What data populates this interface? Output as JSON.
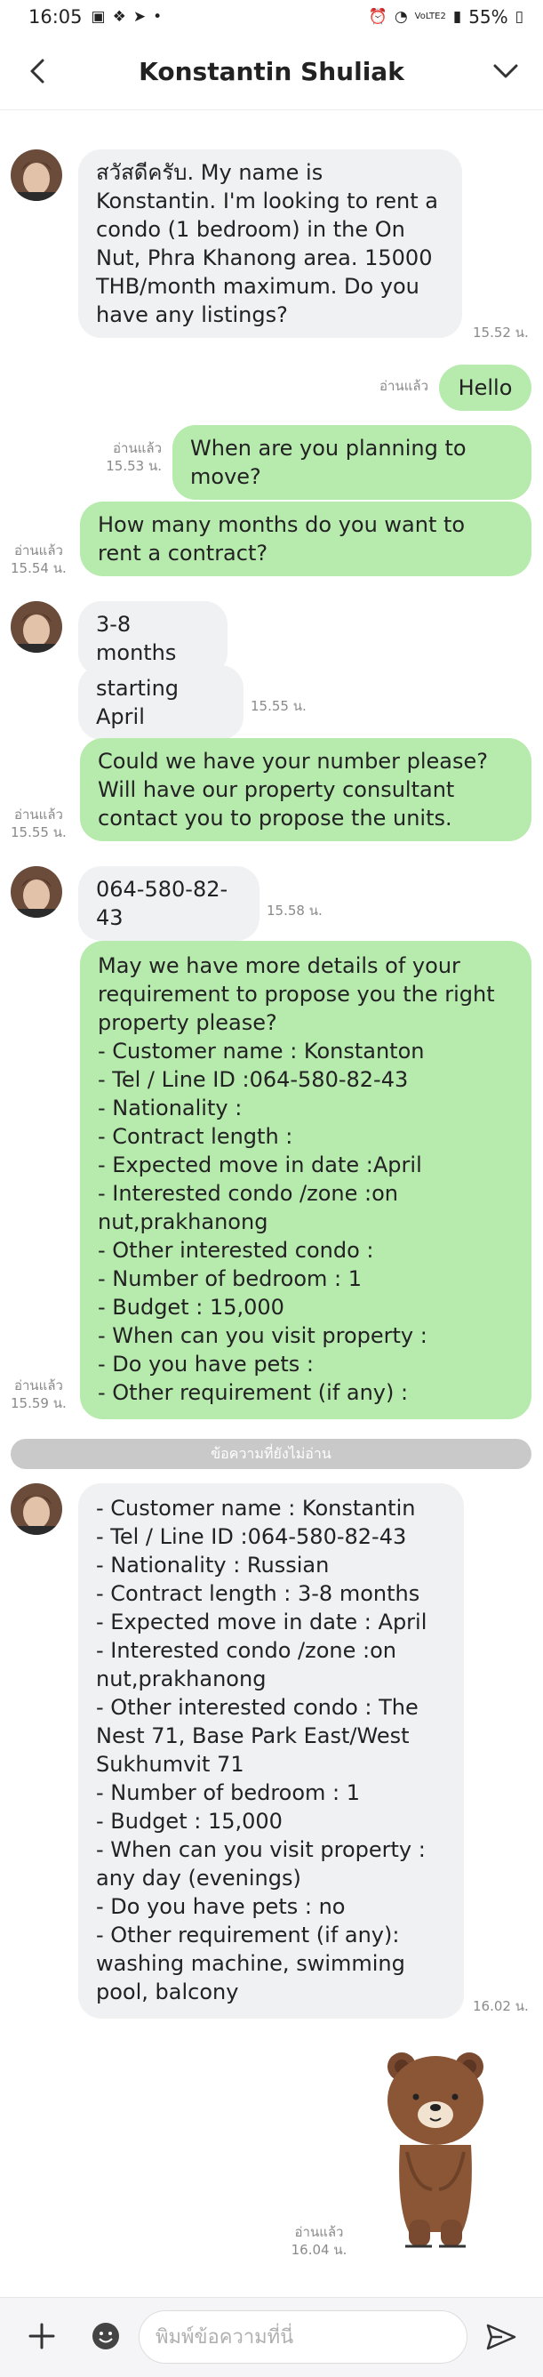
{
  "status_bar": {
    "time": "16:05",
    "battery": "55%",
    "network": "VoLTE2"
  },
  "header": {
    "title": "Konstantin Shuliak"
  },
  "messages": [
    {
      "text": "สวัสดีครับ. My name is Konstantin. I'm looking to rent a condo (1 bedroom) in the On Nut, Phra Khanong area. 15000 THB/month maximum. Do you have any listings?",
      "time": "15.52 น."
    },
    {
      "text": "Hello",
      "read": "อ่านแล้ว"
    },
    {
      "text": "When are you planning to move?",
      "read": "อ่านแล้ว",
      "time": "15.53 น."
    },
    {
      "text": "How many months do you want to rent a contract?",
      "read": "อ่านแล้ว",
      "time": "15.54 น."
    },
    {
      "text": "3-8 months"
    },
    {
      "text": "starting April",
      "time": "15.55 น."
    },
    {
      "text": "Could we have your number please? Will have our property consultant contact you to propose the units.",
      "read": "อ่านแล้ว",
      "time": "15.55 น."
    },
    {
      "text": "064-580-82-43",
      "time": "15.58 น."
    },
    {
      "text": "May we have more details of your requirement to propose you the right property please?\n- Customer name : Konstanton\n- Tel / Line ID :064-580-82-43\n- Nationality :\n- Contract length :\n- Expected move in date :April\n- Interested condo /zone :on nut,prakhanong\n- Other interested condo :\n- Number of bedroom  : 1\n- Budget : 15,000\n- When can you visit property :\n- Do you have pets :\n- Other requirement (if any) :",
      "read": "อ่านแล้ว",
      "time": "15.59 น."
    },
    {
      "text": "- Customer name : Konstantin\n- Tel / Line ID :064-580-82-43\n- Nationality : Russian\n- Contract length :  3-8 months\n- Expected move in date : April\n- Interested condo /zone :on nut,prakhanong\n- Other interested condo : The Nest 71, Base Park East/West Sukhumvit 71\n- Number of bedroom  : 1\n- Budget : 15,000\n- When can you visit property : any day (evenings)\n- Do you have pets : no\n- Other requirement (if any): washing machine, swimming pool, balcony",
      "time": "16.02 น."
    },
    {
      "sticker": "brown-bear-sticker",
      "read": "อ่านแล้ว",
      "time": "16.04 น."
    }
  ],
  "unread_divider": "ข้อความที่ยังไม่อ่าน",
  "input": {
    "placeholder": "พิมพ์ข้อความที่นี่"
  },
  "colors": {
    "outgoing_bubble": "#b7ebae",
    "incoming_bubble": "#f0f1f3",
    "divider": "#c9c9c9"
  },
  "icons": [
    "back-arrow-icon",
    "chevron-down-icon",
    "plus-icon",
    "emoji-icon",
    "send-icon"
  ]
}
